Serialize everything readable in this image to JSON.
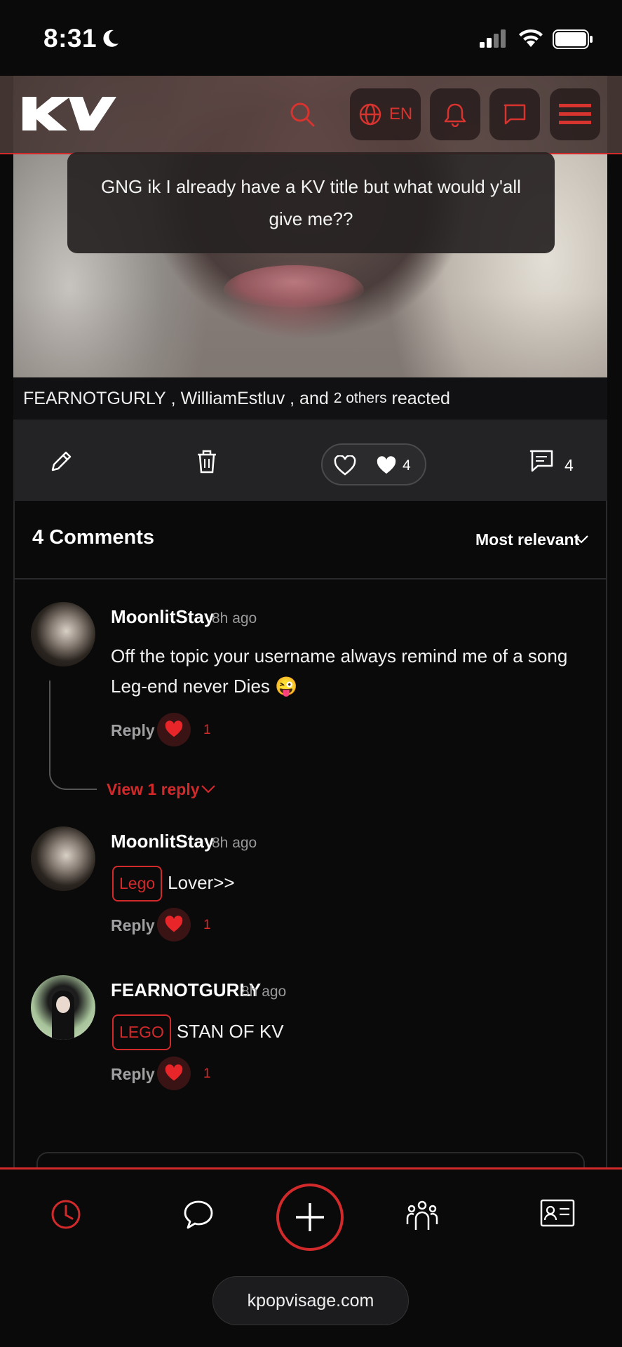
{
  "status_bar": {
    "time": "8:31"
  },
  "header": {
    "logo": "KV",
    "lang": "EN"
  },
  "post": {
    "caption": "GNG ik I already have a KV title but what would y'all give me??",
    "reacted": {
      "user1": "FEARNOTGURLY",
      "sep1": " , ",
      "user2": "WilliamEstluv",
      "sep2": " , and ",
      "others": "2 others",
      "suffix": " reacted"
    },
    "likes": "4",
    "comments_count": "4"
  },
  "comments_header": {
    "title": "4 Comments",
    "sort": "Most relevant"
  },
  "comments": [
    {
      "name": "MoonlitStay",
      "time": "8h ago",
      "text": "Off the topic your username always remind me of a song Leg-end never Dies 😜",
      "tag": "",
      "reply": "Reply",
      "likes": "1",
      "view_replies": "View 1 reply"
    },
    {
      "name": "MoonlitStay",
      "time": "8h ago",
      "tag": "Lego",
      "text": "Lover>>",
      "reply": "Reply",
      "likes": "1"
    },
    {
      "name": "FEARNOTGURLY",
      "time": "8h ago",
      "tag": "LEGO",
      "text": "STAN OF KV",
      "reply": "Reply",
      "likes": "1"
    }
  ],
  "bottom": {
    "url": "kpopvisage.com"
  },
  "colors": {
    "accent": "#d2292b",
    "background": "#0a0a0b"
  },
  "icons": [
    "moon-icon",
    "signal-icon",
    "wifi-icon",
    "battery-icon",
    "search-icon",
    "globe-icon",
    "bell-icon",
    "chat-icon",
    "menu-icon",
    "pencil-icon",
    "trash-icon",
    "heart-outline-icon",
    "heart-filled-icon",
    "comment-icon",
    "chevron-down-icon",
    "clock-icon",
    "speech-bubble-icon",
    "plus-icon",
    "community-icon",
    "profile-card-icon"
  ]
}
